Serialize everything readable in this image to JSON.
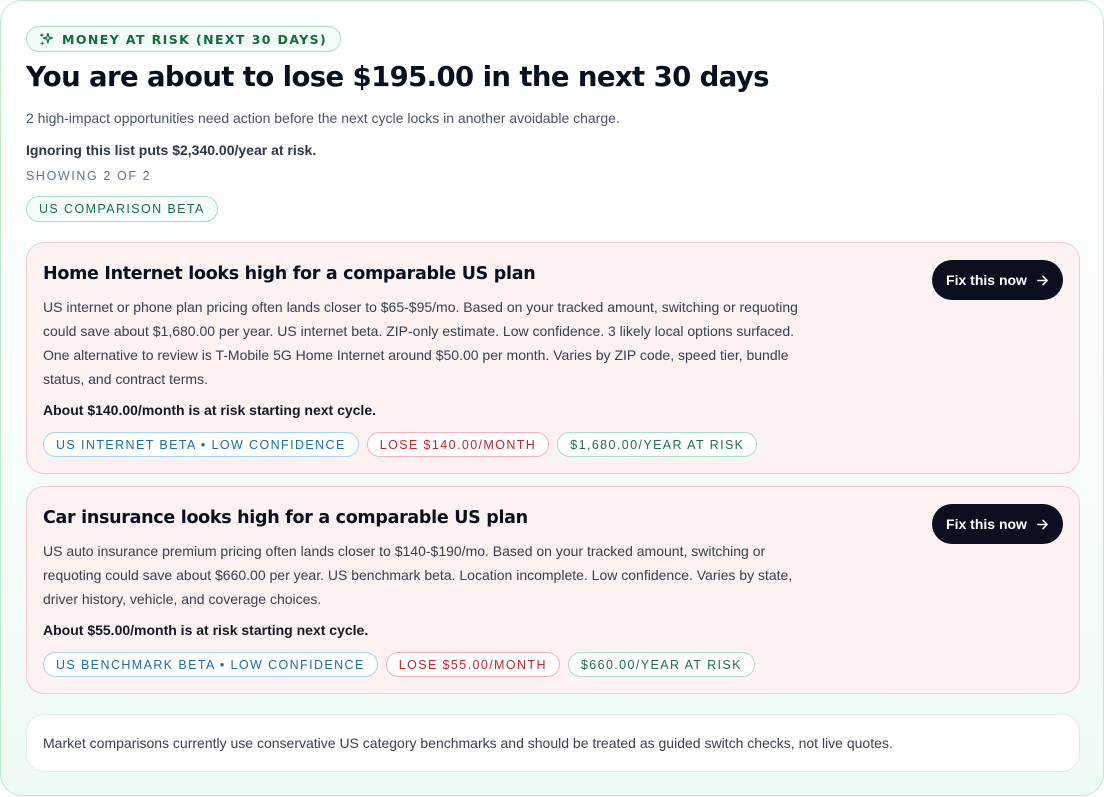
{
  "header": {
    "eyebrow": "MONEY AT RISK (NEXT 30 DAYS)",
    "eyebrow_icon": "sparkles-icon",
    "headline": "You are about to lose $195.00 in the next 30 days",
    "subtitle": "2 high-impact opportunities need action before the next cycle locks in another avoidable charge.",
    "annual_risk": "Ignoring this list puts $2,340.00/year at risk.",
    "showing": "SHOWING 2 OF 2",
    "beta_chip": "US COMPARISON BETA"
  },
  "cards": [
    {
      "title": "Home Internet looks high for a comparable US plan",
      "body": "US internet or phone plan pricing often lands closer to $65-$95/mo. Based on your tracked amount, switching or requoting could save about $1,680.00 per year. US internet beta. ZIP-only estimate. Low confidence. 3 likely local options surfaced. One alternative to review is T-Mobile 5G Home Internet around $50.00 per month. Varies by ZIP code, speed tier, bundle status, and contract terms.",
      "risk": "About $140.00/month is at risk starting next cycle.",
      "tags": [
        "US INTERNET BETA • LOW CONFIDENCE",
        "LOSE $140.00/MONTH",
        "$1,680.00/YEAR AT RISK"
      ],
      "cta": "Fix this now"
    },
    {
      "title": "Car insurance looks high for a comparable US plan",
      "body": "US auto insurance premium pricing often lands closer to $140-$190/mo. Based on your tracked amount, switching or requoting could save about $660.00 per year. US benchmark beta. Location incomplete. Low confidence. Varies by state, driver history, vehicle, and coverage choices.",
      "risk": "About $55.00/month is at risk starting next cycle.",
      "tags": [
        "US BENCHMARK BETA • LOW CONFIDENCE",
        "LOSE $55.00/MONTH",
        "$660.00/YEAR AT RISK"
      ],
      "cta": "Fix this now"
    }
  ],
  "footnote": "Market comparisons currently use conservative US category benchmarks and should be treated as guided switch checks, not live quotes.",
  "colors": {
    "accent_green": "#116b3e",
    "card_background": "#fdf1f1",
    "cta_background": "#0a0e1f",
    "loss_red": "#c0262d",
    "info_blue": "#1b6fa0"
  }
}
